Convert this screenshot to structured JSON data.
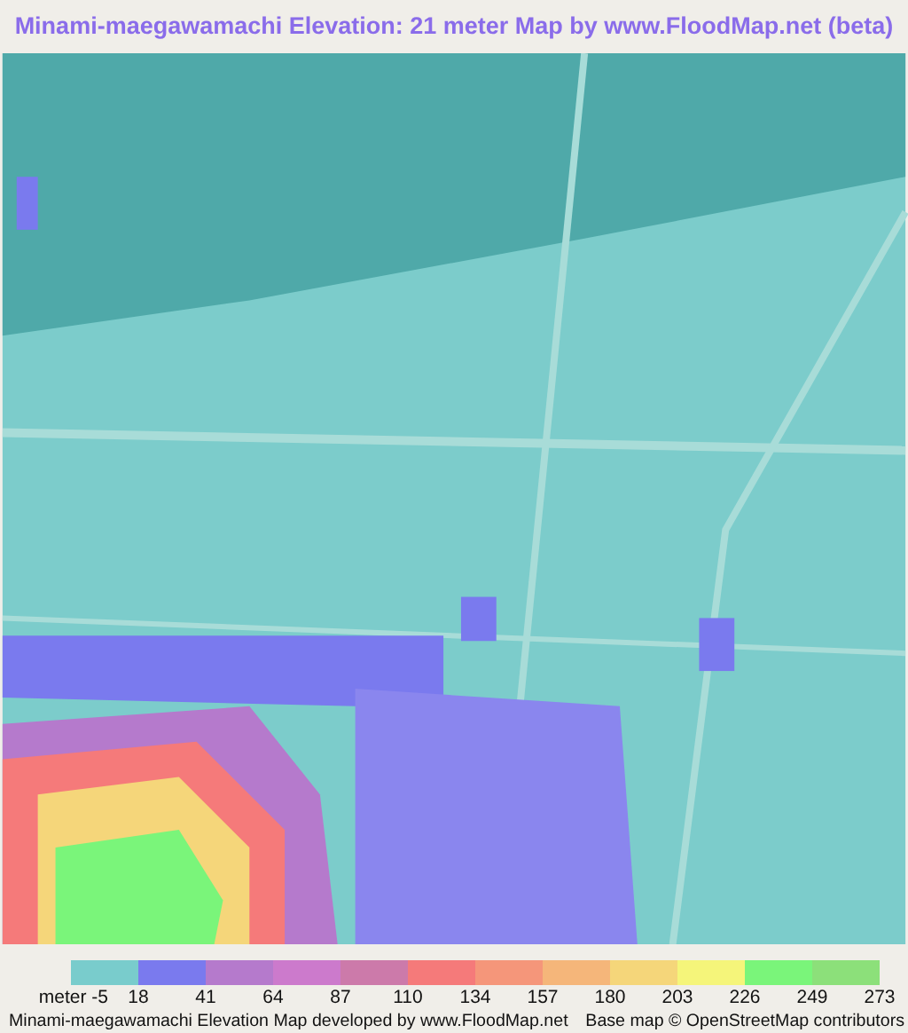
{
  "title": "Minami-maegawamachi Elevation: 21 meter Map by www.FloodMap.net (beta)",
  "legend": {
    "swatches": [
      {
        "color": "#79cccc"
      },
      {
        "color": "#7a7aee"
      },
      {
        "color": "#b57acc"
      },
      {
        "color": "#cc7acc"
      },
      {
        "color": "#cc7aaa"
      },
      {
        "color": "#f57a7a"
      },
      {
        "color": "#f5967a"
      },
      {
        "color": "#f5b67a"
      },
      {
        "color": "#f5d67a"
      },
      {
        "color": "#f5f57a"
      },
      {
        "color": "#7af57a"
      },
      {
        "color": "#8ce07a"
      }
    ],
    "labels": [
      "meter -5",
      "18",
      "41",
      "64",
      "87",
      "110",
      "134",
      "157",
      "180",
      "203",
      "226",
      "249",
      "273"
    ]
  },
  "footer": {
    "credit": "Minami-maegawamachi Elevation Map developed by www.FloodMap.net",
    "attribution": "Base map © OpenStreetMap contributors"
  }
}
